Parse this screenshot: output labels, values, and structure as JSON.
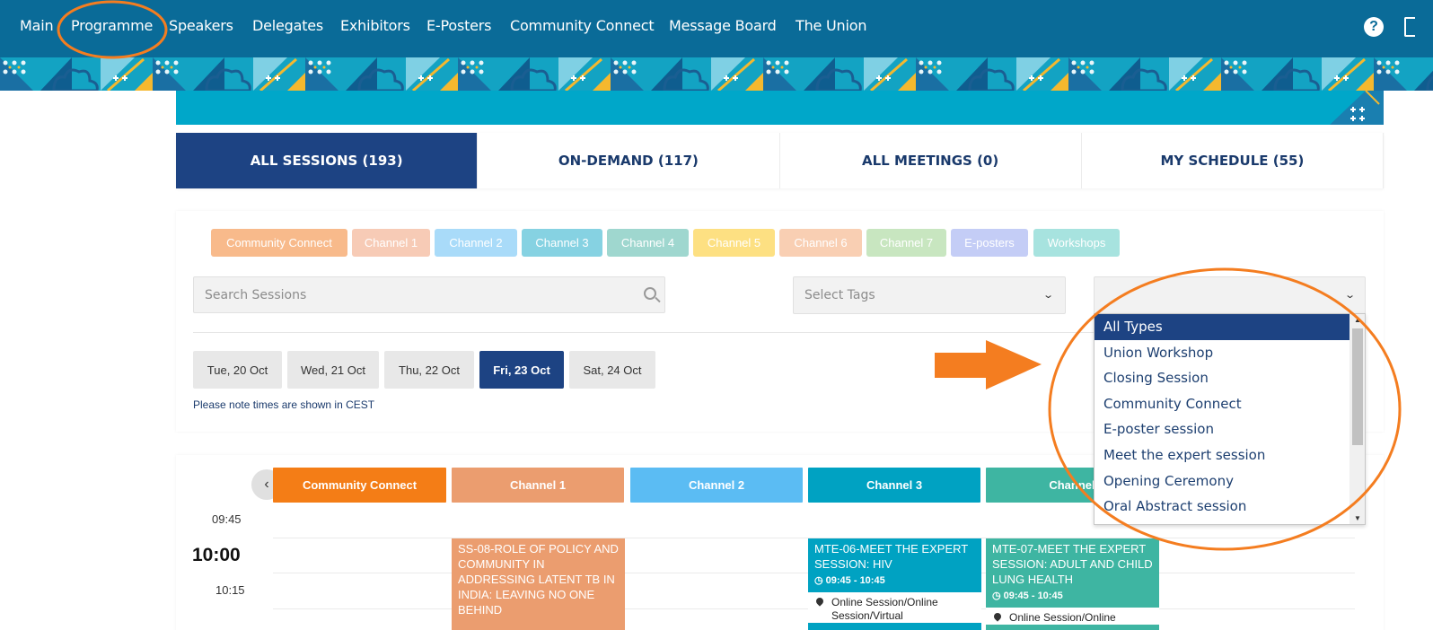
{
  "nav": {
    "items": [
      "Main",
      "Programme",
      "Speakers",
      "Delegates",
      "Exhibitors",
      "E-Posters",
      "Community Connect",
      "Message Board",
      "The Union"
    ],
    "help_icon": "?"
  },
  "tabs": [
    {
      "label": "ALL SESSIONS (193)",
      "active": true
    },
    {
      "label": "ON-DEMAND (117)"
    },
    {
      "label": "ALL MEETINGS (0)"
    },
    {
      "label": "MY SCHEDULE (55)"
    }
  ],
  "chips": [
    {
      "label": "Community Connect",
      "color": "#f8ba8b"
    },
    {
      "label": "Channel 1",
      "color": "#f7cbb6"
    },
    {
      "label": "Channel 2",
      "color": "#a9dbf9"
    },
    {
      "label": "Channel 3",
      "color": "#86d2e2"
    },
    {
      "label": "Channel 4",
      "color": "#9fd7cf"
    },
    {
      "label": "Channel 5",
      "color": "#fde082"
    },
    {
      "label": "Channel 6",
      "color": "#f9cfb3"
    },
    {
      "label": "Channel 7",
      "color": "#c8e6c0"
    },
    {
      "label": "E-posters",
      "color": "#c4cdf6"
    },
    {
      "label": "Workshops",
      "color": "#a7e3df"
    }
  ],
  "filters": {
    "search_placeholder": "Search Sessions",
    "tags_placeholder": "Select Tags",
    "type_value": ""
  },
  "days": [
    {
      "label": "Tue, 20 Oct"
    },
    {
      "label": "Wed, 21 Oct"
    },
    {
      "label": "Thu, 22 Oct"
    },
    {
      "label": "Fri, 23 Oct",
      "active": true
    },
    {
      "label": "Sat, 24 Oct"
    }
  ],
  "note": "Please note times are shown in CEST",
  "channels": [
    {
      "label": "Community Connect",
      "color": "#f47d16"
    },
    {
      "label": "Channel 1",
      "color": "#eb9d6f"
    },
    {
      "label": "Channel 2",
      "color": "#5bbcf3"
    },
    {
      "label": "Channel 3",
      "color": "#00a2c2"
    },
    {
      "label": "Channel",
      "color": "#3eb5a2"
    }
  ],
  "times": [
    "09:45",
    "10:00",
    "10:15"
  ],
  "sessions": [
    {
      "title": "SS-08-ROLE OF POLICY AND COMMUNITY IN ADDRESSING LATENT TB IN INDIA: LEAVING NO ONE BEHIND",
      "color": "#eb9d6f"
    },
    {
      "title": "MTE-06-MEET THE EXPERT SESSION: HIV",
      "time": "09:45 - 10:45",
      "location": "Online Session/Online Session/Virtual",
      "color": "#00a2c2"
    },
    {
      "title": "MTE-07-MEET THE EXPERT SESSION: ADULT AND CHILD LUNG HEALTH",
      "time": "09:45 - 10:45",
      "location": "Online Session/Online",
      "color": "#3eb5a2"
    }
  ],
  "dropdown": {
    "options": [
      "All Types",
      "Union Workshop",
      "Closing Session",
      "Community Connect",
      "E-poster session",
      "Meet the expert session",
      "Opening Ceremony",
      "Oral Abstract session"
    ],
    "selected": "All Types"
  },
  "annotation_color": "#f47d20"
}
